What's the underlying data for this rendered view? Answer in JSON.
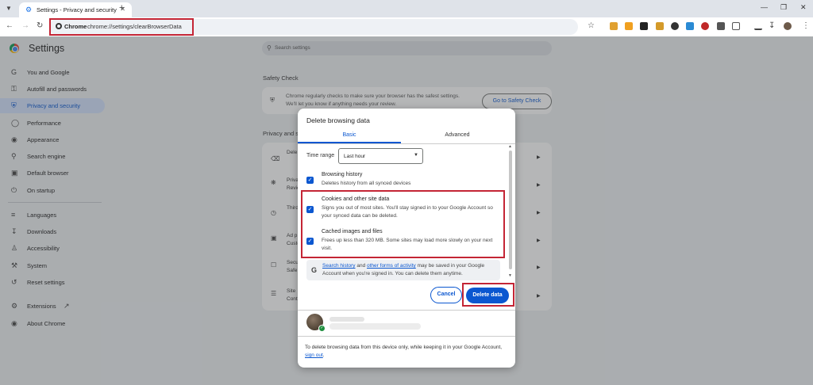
{
  "browser": {
    "tab_title": "Settings - Privacy and security",
    "omnibox_chip": "Chrome",
    "url": "chrome://settings/clearBrowserData"
  },
  "settings": {
    "title": "Settings",
    "search_placeholder": "Search settings",
    "sidebar": [
      {
        "label": "You and Google",
        "icon": "google-icon"
      },
      {
        "label": "Autofill and passwords",
        "icon": "key-icon"
      },
      {
        "label": "Privacy and security",
        "icon": "shield-icon",
        "active": true
      },
      {
        "label": "Performance",
        "icon": "speedometer-icon"
      },
      {
        "label": "Appearance",
        "icon": "palette-icon"
      },
      {
        "label": "Search engine",
        "icon": "search-icon"
      },
      {
        "label": "Default browser",
        "icon": "browser-icon"
      },
      {
        "label": "On startup",
        "icon": "power-icon"
      },
      {
        "label": "Languages",
        "icon": "translate-icon"
      },
      {
        "label": "Downloads",
        "icon": "download-icon"
      },
      {
        "label": "Accessibility",
        "icon": "accessibility-icon"
      },
      {
        "label": "System",
        "icon": "wrench-icon"
      },
      {
        "label": "Reset settings",
        "icon": "reset-icon"
      },
      {
        "label": "Extensions",
        "icon": "extension-icon"
      },
      {
        "label": "About Chrome",
        "icon": "chrome-icon"
      }
    ],
    "safety_check_heading": "Safety Check",
    "safety_text_1": "Chrome regularly checks to make sure your browser has the safest settings.",
    "safety_text_2": "We'll let you know if anything needs your review.",
    "safety_button": "Go to Safety Check",
    "privacy_heading": "Privacy and s",
    "rows": [
      {
        "title": "Dele",
        "sub": ""
      },
      {
        "title": "Priva",
        "sub": "Revie"
      },
      {
        "title": "Third",
        "sub": ""
      },
      {
        "title": "Ad p",
        "sub": "Custo"
      },
      {
        "title": "Secu",
        "sub": "Safe"
      },
      {
        "title": "Site",
        "sub": "Contr"
      }
    ]
  },
  "dialog": {
    "title": "Delete browsing data",
    "tabs": {
      "basic": "Basic",
      "advanced": "Advanced"
    },
    "time_range_label": "Time range",
    "time_range_value": "Last hour",
    "options": [
      {
        "title": "Browsing history",
        "desc": "Deletes history from all synced devices",
        "checked": true
      },
      {
        "title": "Cookies and other site data",
        "desc": "Signs you out of most sites. You'll stay signed in to your Google Account so your synced data can be deleted.",
        "checked": true
      },
      {
        "title": "Cached images and files",
        "desc": "Frees up less than 320 MB. Some sites may load more slowly on your next visit.",
        "checked": true
      }
    ],
    "note": {
      "link1": "Search history",
      "and": " and ",
      "link2": "other forms of activity",
      "rest": " may be saved in your Google Account when you're signed in. You can delete them anytime."
    },
    "cancel": "Cancel",
    "delete": "Delete data",
    "footer": "To delete browsing data from this device only, while keeping it in your Google Account, ",
    "footer_link": "sign out",
    "footer_end": "."
  },
  "colors": {
    "accent": "#0b57d0",
    "highlight": "#c42535"
  }
}
